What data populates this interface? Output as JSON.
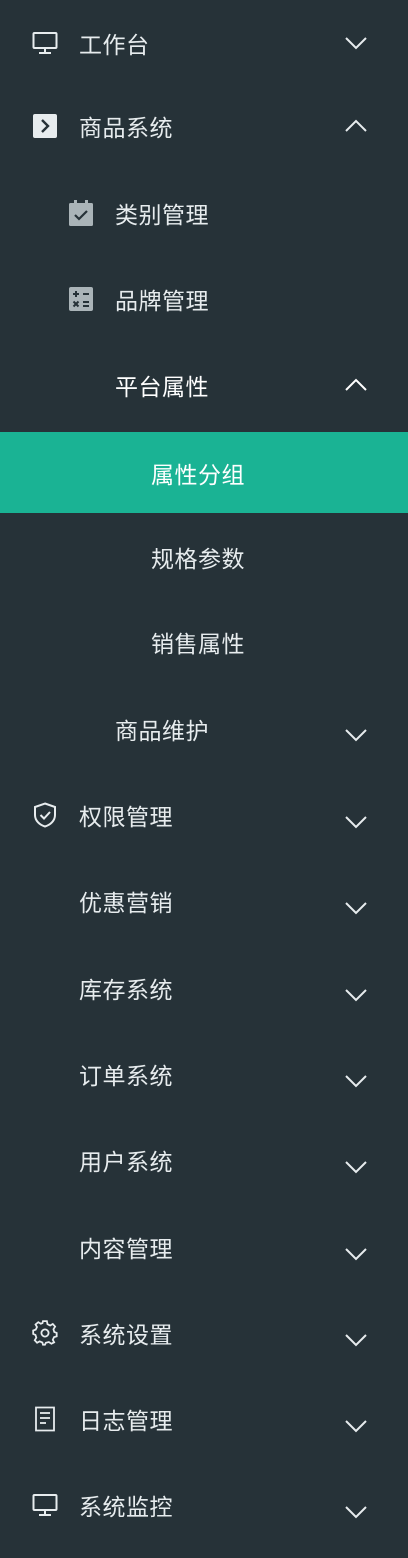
{
  "menu": {
    "workbench": {
      "label": "工作台",
      "icon": "monitor-icon",
      "expanded": false
    },
    "product_system": {
      "label": "商品系统",
      "icon": "arrow-box-icon",
      "expanded": true,
      "children": {
        "category": {
          "label": "类别管理",
          "icon": "calendar-check-icon"
        },
        "brand": {
          "label": "品牌管理",
          "icon": "calculator-icon"
        },
        "platform_attr": {
          "label": "平台属性",
          "expanded": true,
          "children": {
            "attr_group": {
              "label": "属性分组",
              "active": true
            },
            "spec_params": {
              "label": "规格参数"
            },
            "sale_attr": {
              "label": "销售属性"
            }
          }
        },
        "product_maint": {
          "label": "商品维护",
          "expanded": false
        }
      }
    },
    "permission": {
      "label": "权限管理",
      "icon": "shield-check-icon",
      "expanded": false
    },
    "promotion": {
      "label": "优惠营销",
      "expanded": false
    },
    "inventory": {
      "label": "库存系统",
      "expanded": false
    },
    "orders": {
      "label": "订单系统",
      "expanded": false
    },
    "users": {
      "label": "用户系统",
      "expanded": false
    },
    "content": {
      "label": "内容管理",
      "expanded": false
    },
    "settings": {
      "label": "系统设置",
      "icon": "gear-icon",
      "expanded": false
    },
    "logs": {
      "label": "日志管理",
      "icon": "document-icon",
      "expanded": false
    },
    "monitor": {
      "label": "系统监控",
      "icon": "monitor-icon",
      "expanded": false
    }
  },
  "colors": {
    "background": "#263238",
    "active_background": "#1ab394",
    "text": "#e7ecee"
  }
}
